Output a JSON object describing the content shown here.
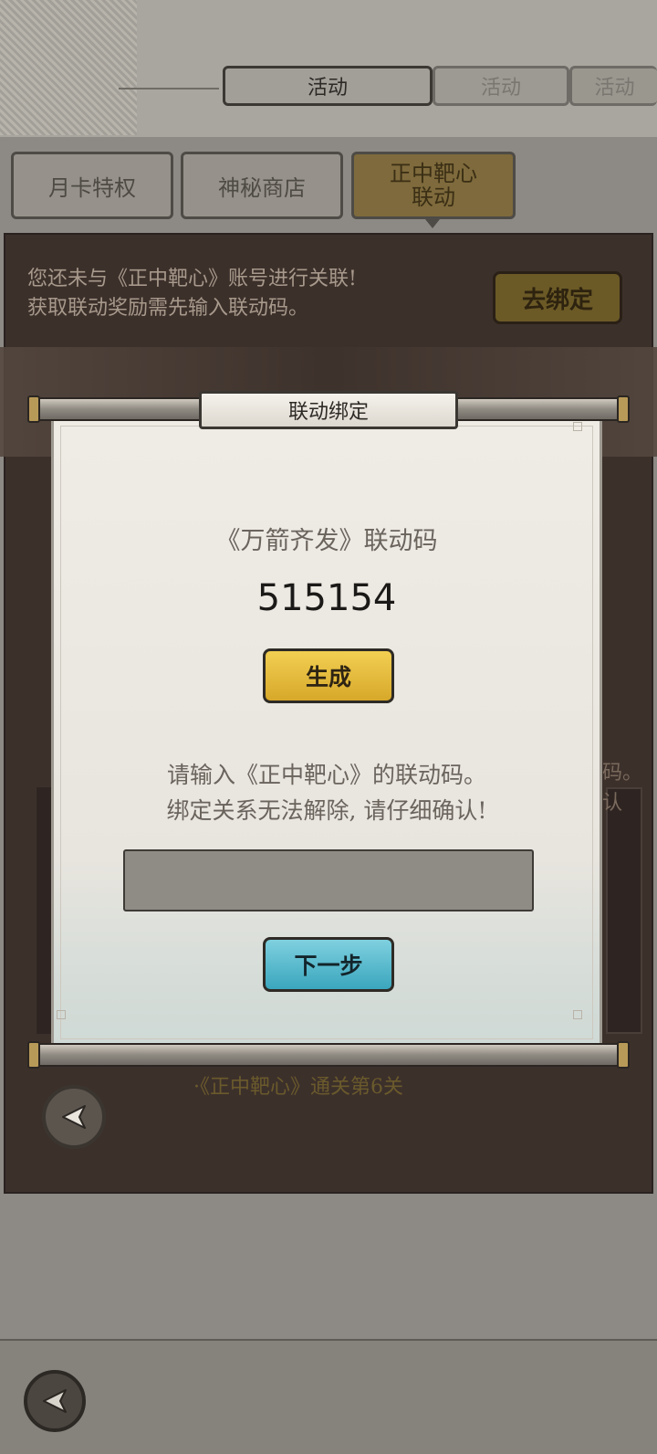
{
  "top_tabs": [
    {
      "label": "活动"
    },
    {
      "label": "活动"
    },
    {
      "label": "活动"
    }
  ],
  "sub_tabs": [
    {
      "label": "月卡特权"
    },
    {
      "label": "神秘商店"
    },
    {
      "label_line1": "正中靶心",
      "label_line2": "联动"
    }
  ],
  "panel": {
    "notice_line1": "您还未与《正中靶心》账号进行关联!",
    "notice_line2": "获取联动奖励需先输入联动码。",
    "go_bind_label": "去绑定",
    "side_text_line1": "码。",
    "side_text_line2": "认",
    "requirement": "·《正中靶心》通关第6关"
  },
  "dialog": {
    "title": "联动绑定",
    "code_label": "《万箭齐发》联动码",
    "code_value": "515154",
    "generate_label": "生成",
    "instruction_line1": "请输入《正中靶心》的联动码。",
    "instruction_line2": "绑定关系无法解除, 请仔细确认!",
    "input_value": "",
    "next_label": "下一步"
  },
  "colors": {
    "generate_button": "#e3b938",
    "next_button": "#57b9cf",
    "panel_bg": "#3c302b"
  },
  "icons": {
    "back": "back-arrow-icon"
  }
}
